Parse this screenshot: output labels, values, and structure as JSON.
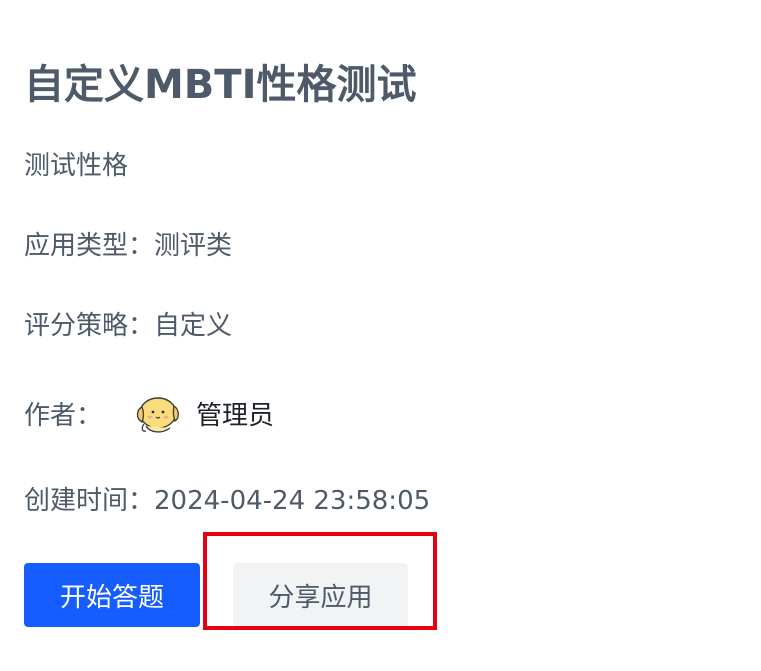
{
  "app": {
    "title": "自定义MBTI性格测试",
    "description": "测试性格"
  },
  "details": {
    "type_label": "应用类型：",
    "type_value": "测评类",
    "score_label": "评分策略：",
    "score_value": "自定义",
    "author_label": "作者：",
    "author_name": "管理员",
    "created_label": "创建时间：",
    "created_value": "2024-04-24 23:58:05"
  },
  "actions": {
    "start_label": "开始答题",
    "share_label": "分享应用"
  },
  "colors": {
    "primary": "#165dff",
    "secondary_bg": "#f2f3f5",
    "text": "#4e5969",
    "highlight": "#e60012"
  }
}
